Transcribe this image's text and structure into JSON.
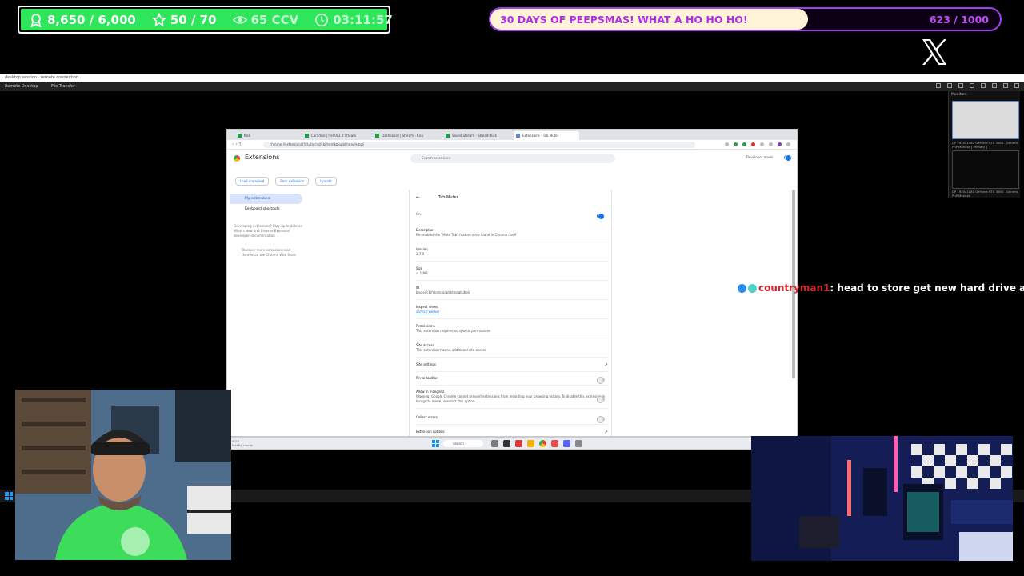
{
  "overlay": {
    "stats": {
      "followers": "8,650 / 6,000",
      "stars": "50 / 70",
      "viewers": "65 CCV",
      "timer": "03:11:57"
    },
    "goal": {
      "title": "30 DAYS OF PEEPSMAS! WHAT A HO HO HO!",
      "count": "623 / 1000",
      "progress_fraction": 0.623
    },
    "social_icon": "x-logo-icon"
  },
  "remote_desktop": {
    "menu_items": [
      "Remote Desktop",
      "File Transfer"
    ],
    "monitors_label": "Monitors",
    "monitor_captions": [
      "DP 1920x1080 GeForce RTX 3060 - Generic PnP Monitor [ Primary ]",
      "DP 1920x1080 GeForce RTX 3060 - Generic PnP Monitor"
    ]
  },
  "browser": {
    "tabs": [
      "Kick",
      "Caradise | ItemXD.it Stream",
      "Dashboard | Stream - Kick",
      "Saved Stream - Stream Kick",
      "Extensions - Tab Muter"
    ],
    "url": "chrome://extensions/?id=bnclejfcbjfnkmkbjopbkhnaglkjbplj",
    "extensions_title": "Extensions",
    "search_placeholder": "Search extensions",
    "developer_mode_label": "Developer mode",
    "dev_buttons": [
      "Load unpacked",
      "Pack extension",
      "Update"
    ],
    "sidebar": {
      "items": [
        "My extensions",
        "Keyboard shortcuts"
      ],
      "note": "Developing extensions? Stay up to date on What's New and Chrome Extension developer documentation",
      "discover": "Discover more extensions and themes on the Chrome Web Store"
    },
    "detail": {
      "name": "Tab Muter",
      "on_label": "On",
      "description_label": "Description",
      "description": "Re-enables the \"Mute Tab\" feature once found in Chrome itself",
      "version_label": "Version",
      "version": "2.7.0",
      "size_label": "Size",
      "size": "< 1 MB",
      "id_label": "ID",
      "id": "bnclejfcbjfnkmkbjopbkhnaglkjbplj",
      "inspect_label": "Inspect views",
      "inspect_link": "service worker",
      "permissions_label": "Permissions",
      "permissions": "This extension requires no special permissions",
      "site_access_label": "Site access",
      "site_access": "This extension has no additional site access",
      "site_settings": "Site settings",
      "pin_toolbar": "Pin to toolbar",
      "incognito_label": "Allow in Incognito",
      "incognito_warning": "Warning: Google Chrome cannot prevent extensions from recording your browsing history. To disable this extension in Incognito mode, unselect this option.",
      "collect_errors": "Collect errors",
      "extension_options": "Extension options"
    },
    "taskbar": {
      "weather_temp": "50°F",
      "weather_desc": "Mostly cloudy",
      "search": "Search"
    }
  },
  "chat": {
    "user": "countryman1",
    "message": ": head to store get new hard drive and s",
    "continuation": "drive"
  }
}
